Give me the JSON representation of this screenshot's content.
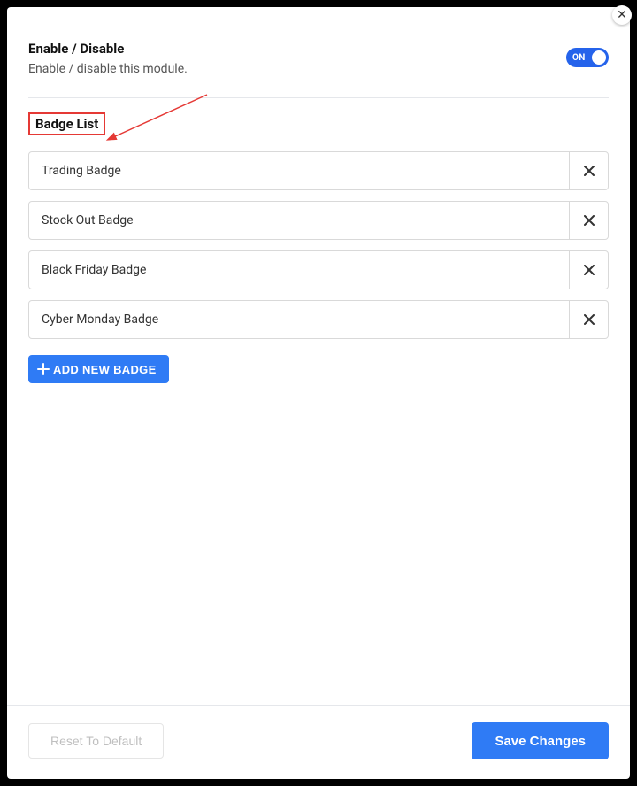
{
  "header": {
    "title": "Enable / Disable",
    "subtitle": "Enable / disable this module.",
    "toggle_state": "ON"
  },
  "section": {
    "title": "Badge List"
  },
  "badges": [
    {
      "label": "Trading Badge"
    },
    {
      "label": "Stock Out Badge"
    },
    {
      "label": "Black Friday Badge"
    },
    {
      "label": "Cyber Monday Badge"
    }
  ],
  "add_button_label": "ADD NEW BADGE",
  "footer": {
    "reset_label": "Reset To Default",
    "save_label": "Save Changes"
  },
  "annotation": {
    "arrow_color": "#e53935",
    "box_color": "#e53935"
  }
}
